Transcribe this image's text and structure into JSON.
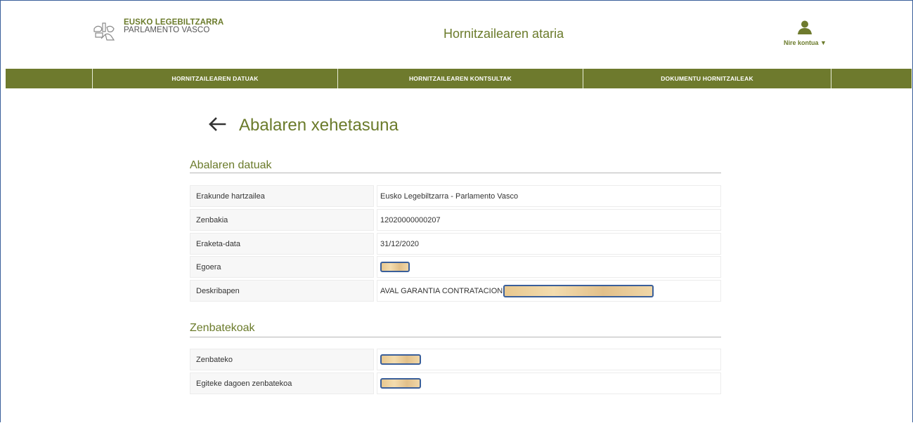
{
  "header": {
    "logo_line1": "EUSKO LEGEBILTZARRA",
    "logo_line2": "PARLAMENTO VASCO",
    "portal_title": "Hornitzailearen ataria",
    "account_label": "Nire kontua ▼"
  },
  "nav": {
    "items": [
      {
        "label": "HORNITZAILEAREN DATUAK"
      },
      {
        "label": "HORNITZAILEAREN KONTSULTAK"
      },
      {
        "label": "DOKUMENTU HORNITZAILEAK"
      }
    ]
  },
  "page": {
    "title": "Abalaren xehetasuna"
  },
  "guarantee_section": {
    "title": "Abalaren datuak",
    "rows": [
      {
        "label": "Erakunde hartzailea",
        "value": "Eusko Legebiltzarra - Parlamento Vasco"
      },
      {
        "label": "Zenbakia",
        "value": "12020000000207"
      },
      {
        "label": "Eraketa-data",
        "value": "31/12/2020"
      },
      {
        "label": "Egoera",
        "value": ""
      },
      {
        "label": "Deskribapen",
        "value": "AVAL GARANTIA CONTRATACION"
      }
    ]
  },
  "amounts_section": {
    "title": "Zenbatekoak",
    "rows": [
      {
        "label": "Zenbateko",
        "value": ""
      },
      {
        "label": "Egiteke dagoen zenbatekoa",
        "value": ""
      }
    ]
  },
  "colors": {
    "brand_green": "#6e7a2d",
    "redaction_border": "#3a5f9a"
  }
}
